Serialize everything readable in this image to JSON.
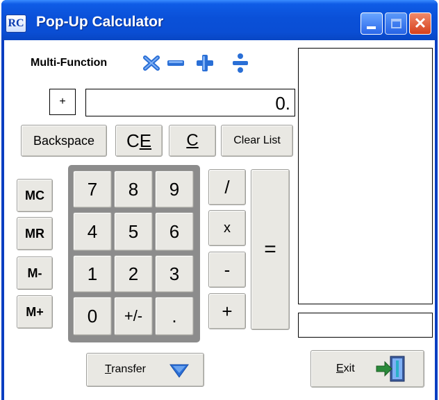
{
  "window": {
    "icon_text": "RC",
    "title": "Pop-Up Calculator"
  },
  "header": {
    "label": "Multi-Function",
    "operator_icons": [
      "multiply-icon",
      "minus-icon",
      "plus-icon",
      "divide-icon"
    ]
  },
  "display": {
    "sign": "+",
    "value": "0."
  },
  "edit_buttons": {
    "backspace": "Backspace",
    "ce": "CE",
    "c": "C",
    "clear_list": "Clear List"
  },
  "memory_buttons": [
    "MC",
    "MR",
    "M-",
    "M+"
  ],
  "keypad": {
    "rows": [
      [
        "7",
        "8",
        "9"
      ],
      [
        "4",
        "5",
        "6"
      ],
      [
        "1",
        "2",
        "3"
      ],
      [
        "0",
        "+/-",
        "."
      ]
    ]
  },
  "operators": [
    "/",
    "x",
    "-",
    "+"
  ],
  "equals": "=",
  "footer": {
    "transfer": "Transfer",
    "exit": "Exit"
  },
  "colors": {
    "titlebar": "#0a4ed4",
    "button_face": "#e9e8e3",
    "keypad_bezel": "#8c8c8c",
    "op_icon_blue": "#2a6fd6"
  }
}
